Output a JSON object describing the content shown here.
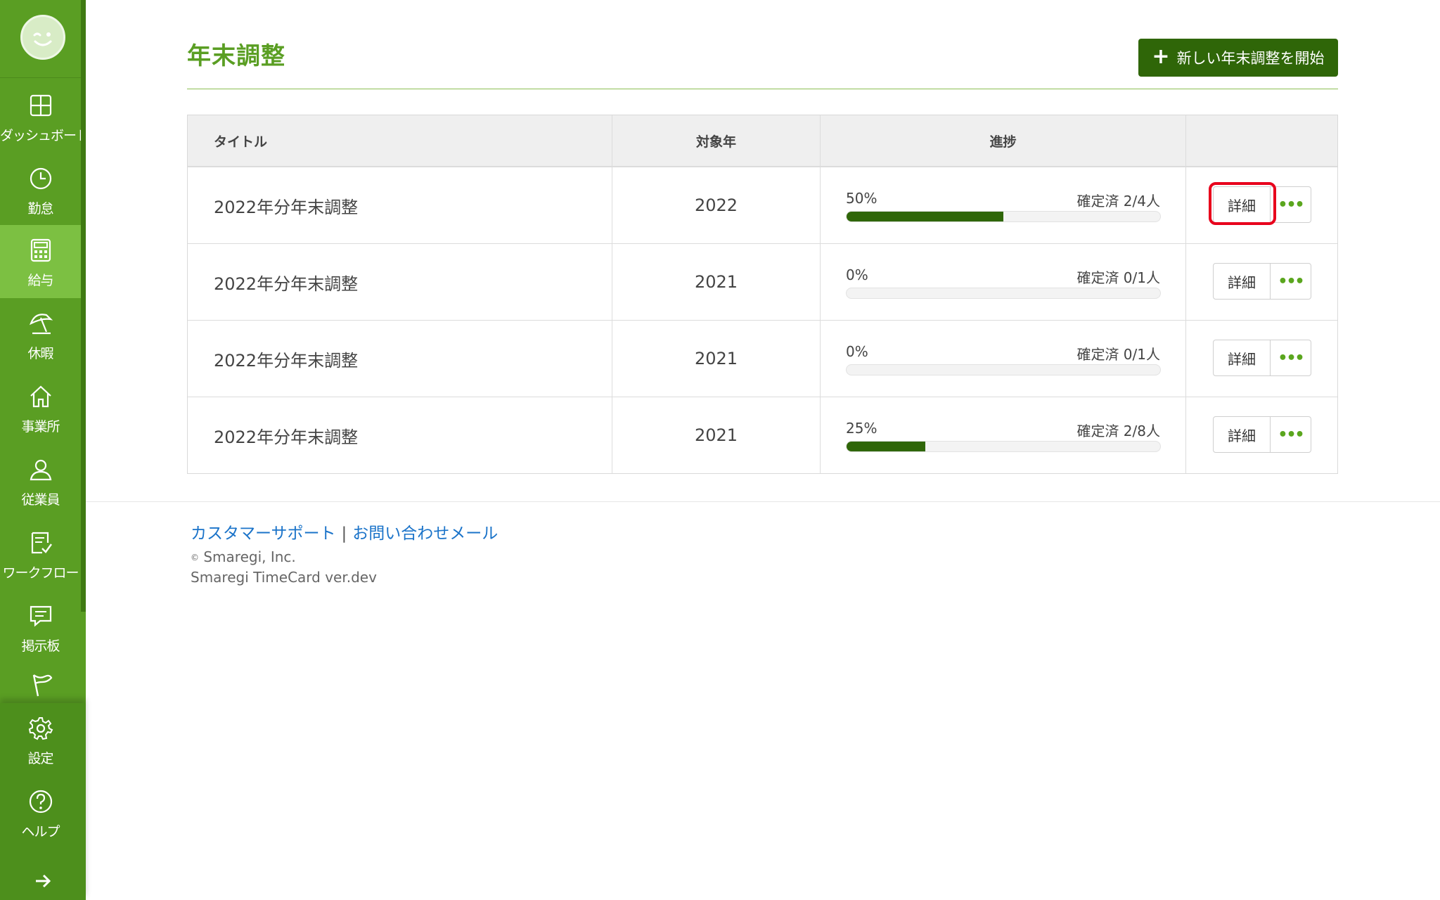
{
  "sidebar": {
    "items": [
      {
        "icon": "dashboard-icon",
        "label": "ダッシュボード",
        "active": false
      },
      {
        "icon": "clock-icon",
        "label": "勤怠",
        "active": false
      },
      {
        "icon": "calculator-icon",
        "label": "給与",
        "active": true
      },
      {
        "icon": "umbrella-icon",
        "label": "休暇",
        "active": false
      },
      {
        "icon": "home-icon",
        "label": "事業所",
        "active": false
      },
      {
        "icon": "person-icon",
        "label": "従業員",
        "active": false
      },
      {
        "icon": "checklist-icon",
        "label": "ワークフロー",
        "active": false
      },
      {
        "icon": "message-icon",
        "label": "掲示板",
        "active": false
      },
      {
        "icon": "flag-icon",
        "label": "",
        "active": false
      }
    ],
    "bottom_items": [
      {
        "icon": "gear-icon",
        "label": "設定"
      },
      {
        "icon": "help-icon",
        "label": "ヘルプ"
      }
    ],
    "expand_icon": "arrow-right-icon"
  },
  "header": {
    "title": "年末調整",
    "new_button_label": "新しい年末調整を開始",
    "new_button_icon": "plus-icon"
  },
  "table": {
    "columns": [
      "タイトル",
      "対象年",
      "進捗",
      ""
    ],
    "rows": [
      {
        "title": "2022年分年末調整",
        "year": "2022",
        "progress_label": "50%",
        "progress": 0.5,
        "status": "確定済 2/4人",
        "detail_label": "詳細",
        "more_label": "•••"
      },
      {
        "title": "2022年分年末調整",
        "year": "2021",
        "progress_label": "0%",
        "progress": 0,
        "status": "確定済 0/1人",
        "detail_label": "詳細",
        "more_label": "•••"
      },
      {
        "title": "2022年分年末調整",
        "year": "2021",
        "progress_label": "0%",
        "progress": 0,
        "status": "確定済 0/1人",
        "detail_label": "詳細",
        "more_label": "•••"
      },
      {
        "title": "2022年分年末調整",
        "year": "2021",
        "progress_label": "25%",
        "progress": 0.25,
        "status": "確定済 2/8人",
        "detail_label": "詳細",
        "more_label": "•••"
      }
    ]
  },
  "footer": {
    "support_link": "カスタマーサポート",
    "separator": "|",
    "mail_link": "お問い合わせメール",
    "copyright_symbol": "©",
    "copyright": "Smaregi, Inc.",
    "version": "Smaregi TimeCard ver.dev"
  },
  "colors": {
    "sidebar": "#5a9e23",
    "sidebar_active": "#7cc042",
    "primary_button": "#2f6608",
    "progress_fill": "#2f6608",
    "link": "#1a73c9",
    "highlight": "#e8001c"
  }
}
